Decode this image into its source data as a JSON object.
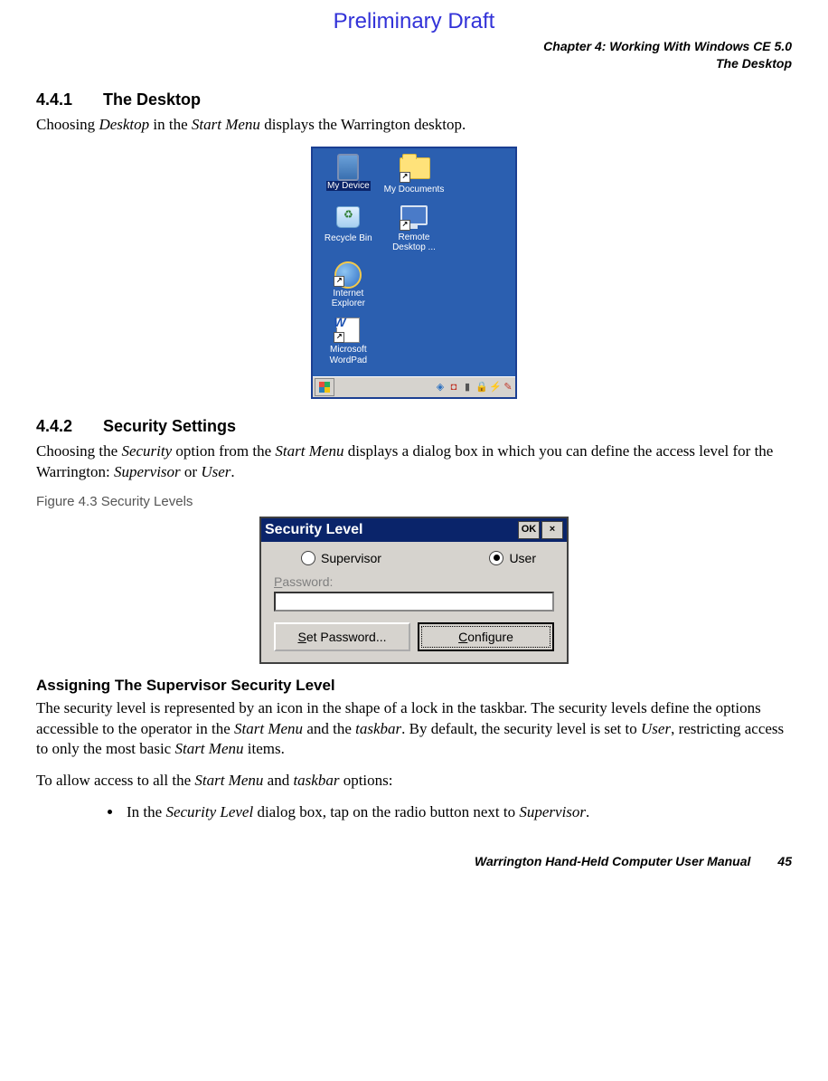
{
  "watermark": "Preliminary Draft",
  "header": {
    "chapter": "Chapter 4:  Working With Windows CE 5.0",
    "section": "The Desktop"
  },
  "sec1": {
    "num": "4.4.1",
    "title": "The Desktop",
    "p1_a": "Choosing ",
    "p1_i1": "Desktop",
    "p1_b": " in the ",
    "p1_i2": "Start Menu",
    "p1_c": " displays the Warrington desktop."
  },
  "desktop": {
    "icons": {
      "myDevice": "My Device",
      "myDocuments": "My Documents",
      "recycleBin": "Recycle Bin",
      "remoteDesktop": "Remote Desktop ...",
      "ie": "Internet Explorer",
      "wordpad": "Microsoft WordPad"
    }
  },
  "sec2": {
    "num": "4.4.2",
    "title": "Security Settings",
    "p1_a": "Choosing the ",
    "p1_i1": "Security",
    "p1_b": " option from the ",
    "p1_i2": "Start Menu",
    "p1_c": " displays a dialog box in which you can define the access level for the Warrington: ",
    "p1_i3": "Supervisor",
    "p1_d": " or ",
    "p1_i4": "User",
    "p1_e": ".",
    "figcap": "Figure 4.3  Security Levels"
  },
  "dlg": {
    "title": "Security Level",
    "ok": "OK",
    "close": "×",
    "supervisor": "Supervisor",
    "user": "User",
    "pw_label_pre": "P",
    "pw_label_post": "assword:",
    "set_pre": "S",
    "set_post": "et Password...",
    "conf_pre": "C",
    "conf_post": "onfigure"
  },
  "sub": {
    "head": "Assigning The Supervisor Security Level",
    "p1_a": "The security level is represented by an icon in the shape of a lock in the taskbar. The security levels define the options accessible to the operator in the ",
    "p1_i1": "Start Menu",
    "p1_b": " and the ",
    "p1_i2": "taskbar",
    "p1_c": ". By default, the security level is set to ",
    "p1_i3": "User",
    "p1_d": ", restricting access to only the most basic ",
    "p1_i4": "Start Menu",
    "p1_e": " items.",
    "p2_a": "To allow access to all the ",
    "p2_i1": "Start Menu",
    "p2_b": " and ",
    "p2_i2": "taskbar",
    "p2_c": " options:",
    "li_a": "In the ",
    "li_i1": "Security Level",
    "li_b": " dialog box, tap on the radio button next to ",
    "li_i2": "Supervisor",
    "li_c": "."
  },
  "footer": {
    "title": "Warrington Hand-Held Computer User Manual",
    "page": "45"
  }
}
